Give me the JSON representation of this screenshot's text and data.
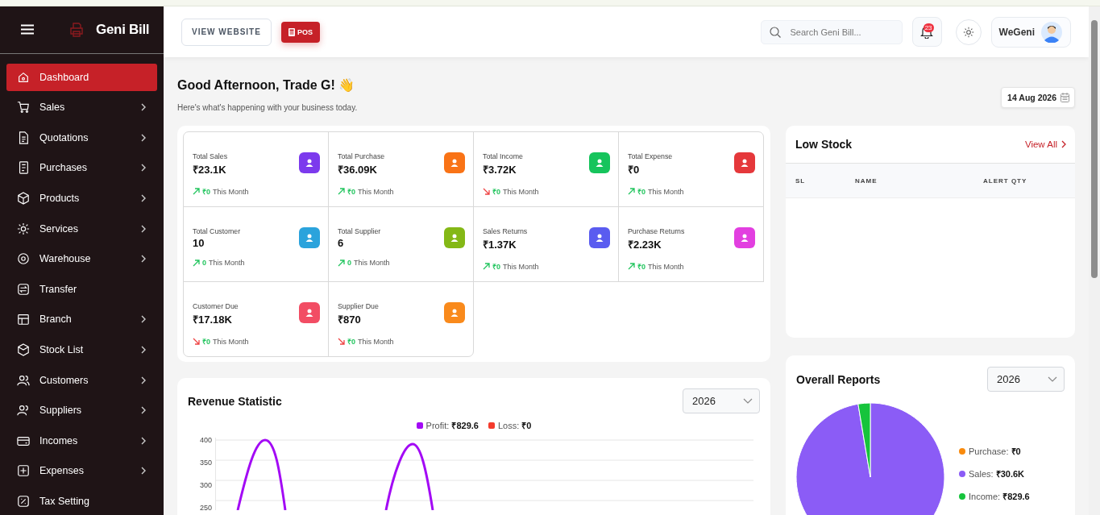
{
  "sidebar": {
    "brand": "Geni Bill",
    "items": [
      {
        "label": "Dashboard",
        "selected": true,
        "submenu": false
      },
      {
        "label": "Sales",
        "selected": false,
        "submenu": true
      },
      {
        "label": "Quotations",
        "selected": false,
        "submenu": true
      },
      {
        "label": "Purchases",
        "selected": false,
        "submenu": true
      },
      {
        "label": "Products",
        "selected": false,
        "submenu": true
      },
      {
        "label": "Services",
        "selected": false,
        "submenu": true
      },
      {
        "label": "Warehouse",
        "selected": false,
        "submenu": true
      },
      {
        "label": "Transfer",
        "selected": false,
        "submenu": false
      },
      {
        "label": "Branch",
        "selected": false,
        "submenu": true
      },
      {
        "label": "Stock List",
        "selected": false,
        "submenu": true
      },
      {
        "label": "Customers",
        "selected": false,
        "submenu": true
      },
      {
        "label": "Suppliers",
        "selected": false,
        "submenu": true
      },
      {
        "label": "Incomes",
        "selected": false,
        "submenu": true
      },
      {
        "label": "Expenses",
        "selected": false,
        "submenu": true
      },
      {
        "label": "Tax Setting",
        "selected": false,
        "submenu": false
      }
    ]
  },
  "header": {
    "view_website": "VIEW WEBSITE",
    "pos": "POS",
    "search": {
      "placeholder": "Search Geni Bill..."
    },
    "notification_count": "23",
    "user": "WeGeni"
  },
  "greeting": {
    "title": "Good Afternoon, Trade G! 👋",
    "subtitle": "Here's what's happening with your business today.",
    "date": "14 Aug 2026"
  },
  "stats": [
    {
      "label": "Total Sales",
      "value": "₹23.1K",
      "trending_up": true,
      "change": "₹0",
      "period": "This Month",
      "color": "#7c3aed"
    },
    {
      "label": "Total Purchase",
      "value": "₹36.09K",
      "trending_up": true,
      "change": "₹0",
      "period": "This Month",
      "color": "#f97316"
    },
    {
      "label": "Total Income",
      "value": "₹3.72K",
      "trending_up": false,
      "change": "₹0",
      "period": "This Month",
      "color": "#16c45c"
    },
    {
      "label": "Total Expense",
      "value": "₹0",
      "trending_up": true,
      "change": "₹0",
      "period": "This Month",
      "color": "#e5383b"
    },
    {
      "label": "Total Customer",
      "value": "10",
      "trending_up": true,
      "change": "0",
      "period": "This Month",
      "color": "#2ba3dc"
    },
    {
      "label": "Total Supplier",
      "value": "6",
      "trending_up": true,
      "change": "0",
      "period": "This Month",
      "color": "#84b816"
    },
    {
      "label": "Sales Returns",
      "value": "₹1.37K",
      "trending_up": true,
      "change": "₹0",
      "period": "This Month",
      "color": "#5a5cf0"
    },
    {
      "label": "Purchase Returns",
      "value": "₹2.23K",
      "trending_up": true,
      "change": "₹0",
      "period": "This Month",
      "color": "#e23fe0"
    },
    {
      "label": "Customer Due",
      "value": "₹17.18K",
      "trending_up": false,
      "change": "₹0",
      "period": "This Month",
      "color": "#f24d64"
    },
    {
      "label": "Supplier Due",
      "value": "₹870",
      "trending_up": false,
      "change": "₹0",
      "period": "This Month",
      "color": "#f98a1c"
    }
  ],
  "revenue": {
    "title": "Revenue Statistic",
    "year": "2026",
    "legend": [
      {
        "text": "Profit: **₹829.6**",
        "color": "#a30af5"
      },
      {
        "text": "Loss: **₹0**",
        "color": "#f43b2c"
      }
    ],
    "y_axis_labels": [
      "400",
      "350",
      "300",
      "250"
    ]
  },
  "low_stock": {
    "title": "Low Stock",
    "view_all": "View All",
    "columns": [
      "SL",
      "NAME",
      "ALERT QTY"
    ]
  },
  "overall_reports": {
    "title": "Overall Reports",
    "year": "2026",
    "legend": [
      {
        "separator": ":",
        "value": "₹0",
        "color": "#f98a0c"
      },
      {
        "separator": ":",
        "value": "₹30.6K",
        "color": "#8b5cf6"
      },
      {
        "separator": ":",
        "value": "₹829.6",
        "color": "#16c43c"
      }
    ],
    "chart_data": {
      "type": "pie",
      "categories": [
        "Purchase",
        "Sales",
        "Income"
      ],
      "values": [
        0,
        97.36,
        2.64
      ]
    }
  }
}
